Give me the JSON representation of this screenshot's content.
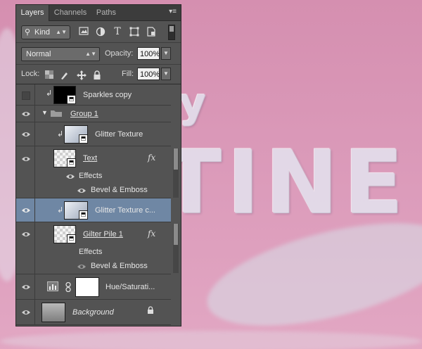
{
  "panel": {
    "tabs": [
      {
        "label": "Layers",
        "active": true
      },
      {
        "label": "Channels",
        "active": false
      },
      {
        "label": "Paths",
        "active": false
      }
    ],
    "menu_icon": "panel-menu-icon"
  },
  "filter": {
    "kind_label": "Kind",
    "icons": [
      "pixel-filter-icon",
      "adjustment-filter-icon",
      "type-filter-icon",
      "shape-filter-icon",
      "smart-object-filter-icon"
    ],
    "type_glyph": "T"
  },
  "blend": {
    "mode": "Normal",
    "opacity_label": "Opacity:",
    "opacity_value": "100%",
    "lock_label": "Lock:",
    "fill_label": "Fill:",
    "fill_value": "100%"
  },
  "layers": [
    {
      "name": "Sparkles copy",
      "visible": false
    },
    {
      "name": "Group 1",
      "visible": true
    },
    {
      "name": "Glitter Texture",
      "visible": true
    },
    {
      "name": "Text",
      "visible": true,
      "effects_label": "Effects",
      "effect": "Bevel & Emboss"
    },
    {
      "name": "Glitter Texture c...",
      "visible": true,
      "selected": true
    },
    {
      "name": "Gilter Pile 1",
      "visible": true,
      "effects_label": "Effects",
      "effect": "Bevel & Emboss"
    },
    {
      "name": "Hue/Saturati...",
      "visible": true
    },
    {
      "name": "Background",
      "visible": true
    }
  ],
  "canvas_text": {
    "line1": "ry",
    "line2": "TINE"
  },
  "fx_label": "fx",
  "colors": {
    "selection": "#6f87a4",
    "panel": "#535353",
    "canvas": "#d493b1"
  }
}
